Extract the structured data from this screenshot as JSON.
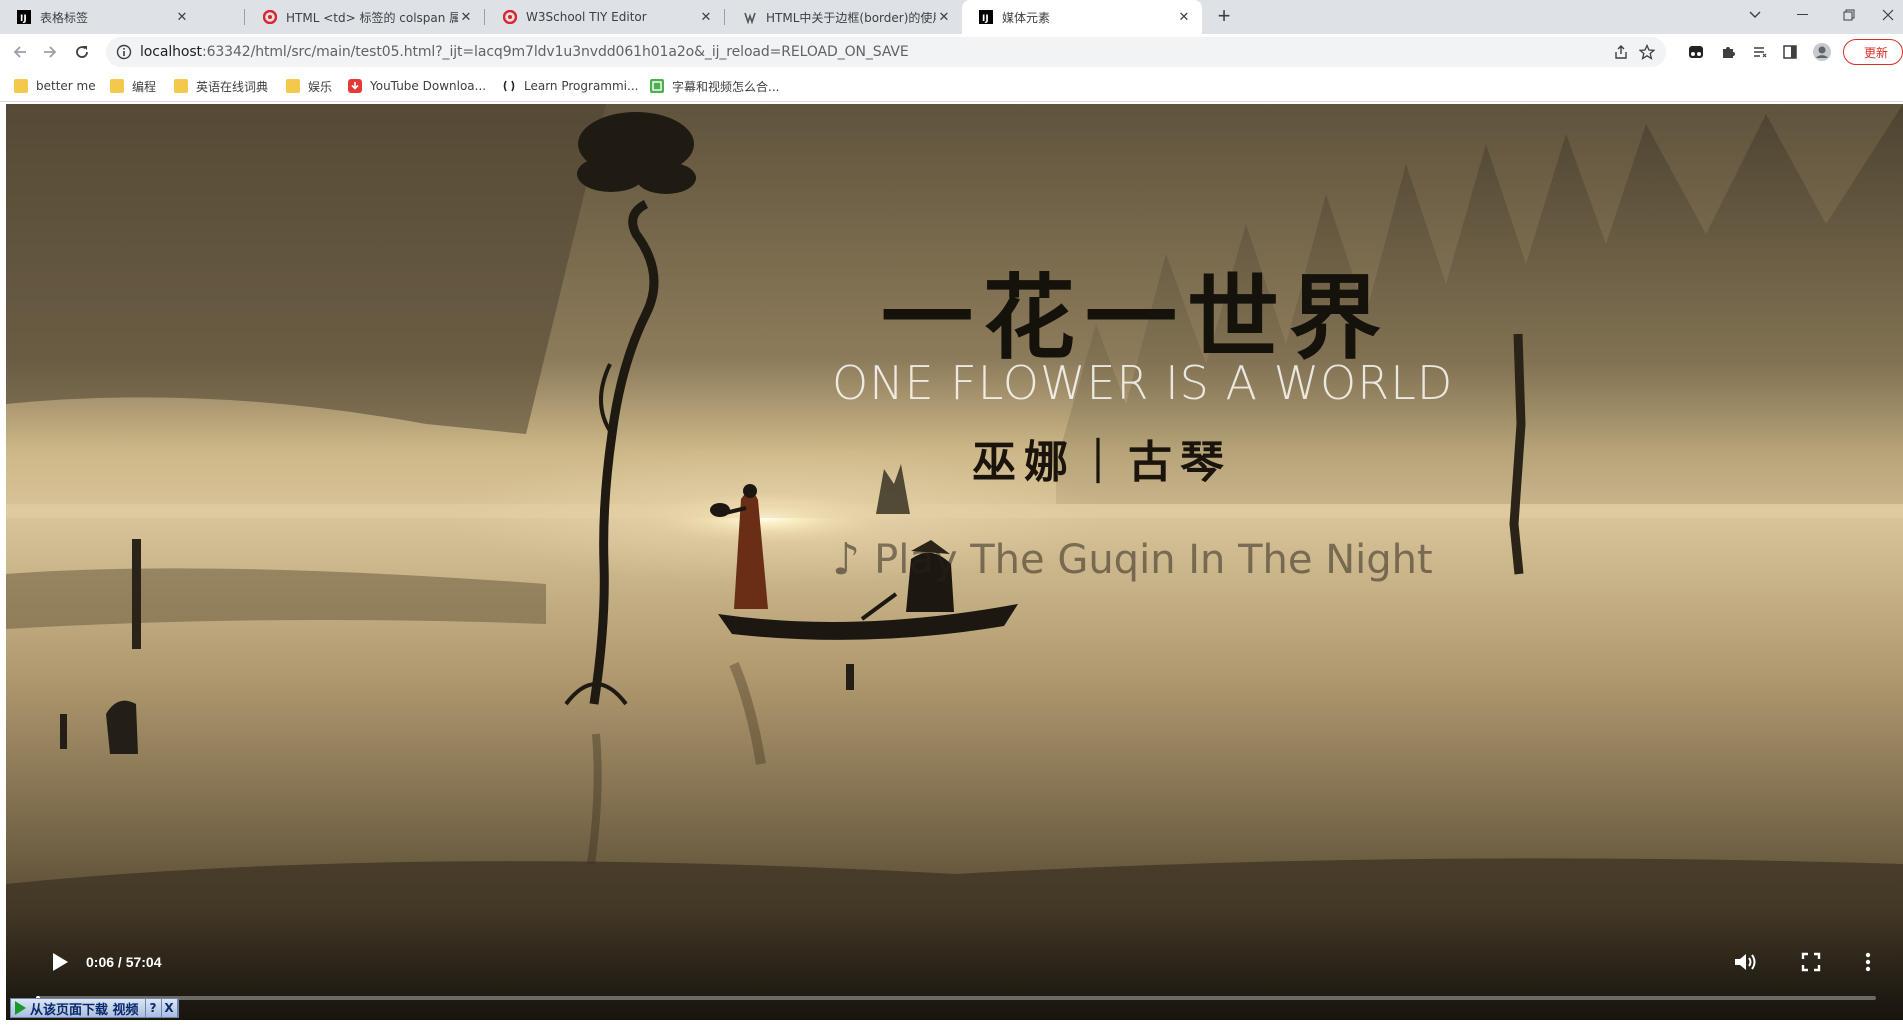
{
  "browser": {
    "tabs": [
      {
        "title": "表格标签",
        "favicon": "jetbrains-icon",
        "active": false
      },
      {
        "title": "HTML <td> 标签的 colspan 属性",
        "favicon": "w3school-icon",
        "active": false
      },
      {
        "title": "W3School TIY Editor",
        "favicon": "w3school-icon",
        "active": false
      },
      {
        "title": "HTML中关于边框(border)的使用",
        "favicon": "w3c-icon",
        "active": false
      },
      {
        "title": "媒体元素",
        "favicon": "jetbrains-icon",
        "active": true
      }
    ],
    "address": {
      "host": "localhost",
      "rest": ":63342/html/src/main/test05.html?_ijt=lacq9m7ldv1u3nvdd061h01a2o&_ij_reload=RELOAD_ON_SAVE"
    },
    "update_label": "更新",
    "bookmarks": [
      {
        "label": "better me",
        "icon": "folder-icon"
      },
      {
        "label": "编程",
        "icon": "folder-icon"
      },
      {
        "label": "英语在线词典",
        "icon": "folder-icon"
      },
      {
        "label": "娱乐",
        "icon": "folder-icon"
      },
      {
        "label": "YouTube Downloa...",
        "icon": "download-icon"
      },
      {
        "label": "Learn Programmi...",
        "icon": "freecodecamp-icon"
      },
      {
        "label": "字幕和视频怎么合...",
        "icon": "green-app-icon"
      }
    ]
  },
  "video": {
    "title_cn": "一花一世界",
    "title_en": "ONE FLOWER IS A WORLD",
    "subtitle_cn": "巫娜｜古琴",
    "track_note": "♪",
    "track_name": "Play The Guqin In The Night",
    "current_time": "0:06",
    "duration": "57:04",
    "timecode": "0:06 / 57:04",
    "progress_fraction": 0.0018
  },
  "download_bar": {
    "label": "从该页面下载 视频",
    "help": "?",
    "close": "X"
  },
  "colors": {
    "tabstrip_bg": "#dee1e6",
    "omnibox_bg": "#f1f3f4",
    "update_red": "#d93025"
  }
}
